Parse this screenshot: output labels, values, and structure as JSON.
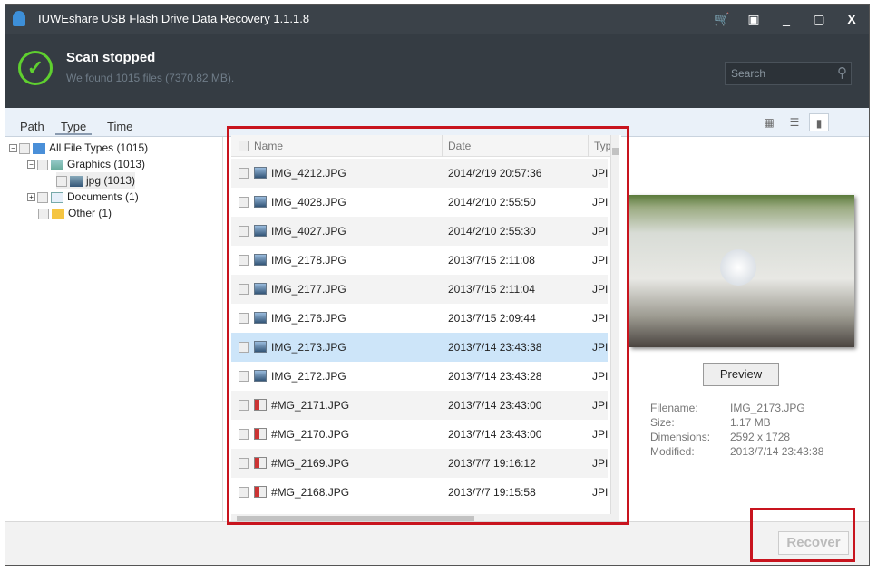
{
  "window": {
    "title": "IUWEshare USB Flash Drive Data Recovery 1.1.1.8",
    "buttons": [
      "cart-icon",
      "menu-icon",
      "minimize-icon",
      "maximize-icon",
      "close-icon"
    ]
  },
  "header": {
    "status": "Scan stopped",
    "summary": "We found 1015 files (7370.82 MB).",
    "search_placeholder": "Search",
    "accent": "#5fd02f"
  },
  "tabs": [
    "Path",
    "Type",
    "Time"
  ],
  "active_tab": "Type",
  "tree": [
    {
      "label": "All File Types (1015)",
      "icon": "computer-icon"
    },
    {
      "label": "Graphics (1013)",
      "icon": "image-icon"
    },
    {
      "label": "jpg (1013)",
      "icon": "image-icon"
    },
    {
      "label": "Documents (1)",
      "icon": "document-icon"
    },
    {
      "label": "Other (1)",
      "icon": "folder-icon"
    }
  ],
  "list": {
    "columns": [
      "Name",
      "Date",
      "Type"
    ],
    "rows": [
      {
        "name": "IMG_4212.JPG",
        "date": "2014/2/19 20:57:36",
        "type": "JPI"
      },
      {
        "name": "IMG_4028.JPG",
        "date": "2014/2/10 2:55:50",
        "type": "JPI"
      },
      {
        "name": "IMG_4027.JPG",
        "date": "2014/2/10 2:55:30",
        "type": "JPI"
      },
      {
        "name": "IMG_2178.JPG",
        "date": "2013/7/15 2:11:08",
        "type": "JPI"
      },
      {
        "name": "IMG_2177.JPG",
        "date": "2013/7/15 2:11:04",
        "type": "JPI"
      },
      {
        "name": "IMG_2176.JPG",
        "date": "2013/7/15 2:09:44",
        "type": "JPI"
      },
      {
        "name": "IMG_2173.JPG",
        "date": "2013/7/14 23:43:38",
        "type": "JPI",
        "selected": true
      },
      {
        "name": "IMG_2172.JPG",
        "date": "2013/7/14 23:43:28",
        "type": "JPI"
      },
      {
        "name": "#MG_2171.JPG",
        "date": "2013/7/14 23:43:00",
        "type": "JPI",
        "damaged": true
      },
      {
        "name": "#MG_2170.JPG",
        "date": "2013/7/14 23:43:00",
        "type": "JPI",
        "damaged": true
      },
      {
        "name": "#MG_2169.JPG",
        "date": "2013/7/7 19:16:12",
        "type": "JPI",
        "damaged": true
      },
      {
        "name": "#MG_2168.JPG",
        "date": "2013/7/7 19:15:58",
        "type": "JPI",
        "damaged": true
      }
    ]
  },
  "preview": {
    "button": "Preview",
    "labels": [
      "Filename:",
      "Size:",
      "Dimensions:",
      "Modified:"
    ],
    "values": [
      "IMG_2173.JPG",
      "1.17 MB",
      "2592 x 1728",
      "2013/7/14 23:43:38"
    ]
  },
  "footer": {
    "recover": "Recover"
  }
}
